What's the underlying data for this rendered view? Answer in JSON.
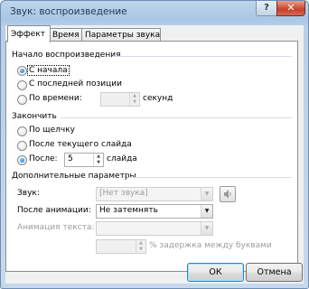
{
  "window": {
    "title": "Звук: воспроизведение",
    "help_label": "?",
    "close_label": "✕"
  },
  "tabs": [
    "Эффект",
    "Время",
    "Параметры звука"
  ],
  "start_group": {
    "label": "Начало воспроизведения",
    "options": [
      "С начала",
      "С последней позиции",
      "По времени:"
    ],
    "selected": 0,
    "time_value": "",
    "time_unit": "секунд"
  },
  "stop_group": {
    "label": "Закончить",
    "options": [
      "По щелчку",
      "После текущего слайда",
      "После:"
    ],
    "selected": 2,
    "after_value": "5",
    "after_unit": "слайда"
  },
  "extra_group": {
    "label": "Дополнительные параметры",
    "sound_label": "Звук:",
    "sound_value": "[Нет звука]",
    "after_anim_label": "После анимации:",
    "after_anim_value": "Не затемнять",
    "text_anim_label": "Анимация текста:",
    "text_anim_value": "",
    "delay_value": "",
    "delay_label": "% задержка между буквами"
  },
  "buttons": {
    "ok": "ОК",
    "cancel": "Отмена"
  }
}
